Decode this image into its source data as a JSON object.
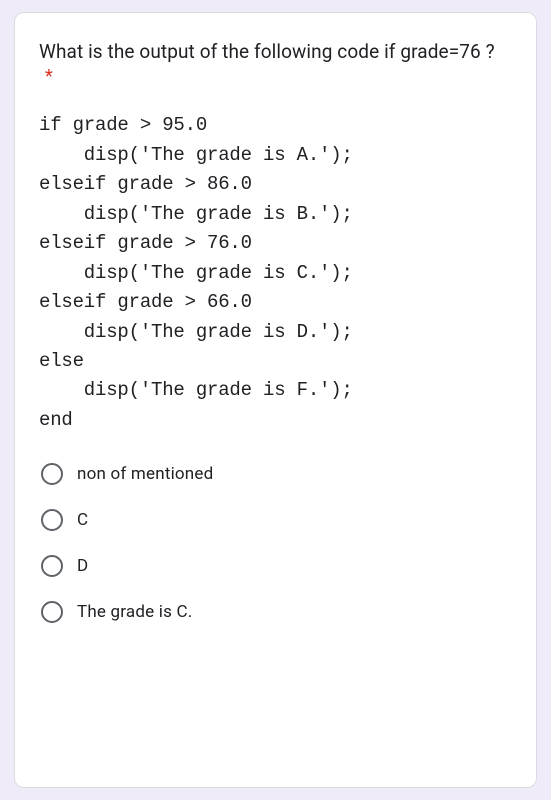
{
  "question": {
    "text": "What is the output of the following code if grade=76 ?",
    "required_mark": "*"
  },
  "code": "if grade > 95.0\n    disp('The grade is A.');\nelseif grade > 86.0\n    disp('The grade is B.');\nelseif grade > 76.0\n    disp('The grade is C.');\nelseif grade > 66.0\n    disp('The grade is D.');\nelse\n    disp('The grade is F.');\nend",
  "options": [
    {
      "label": "non of mentioned"
    },
    {
      "label": "C"
    },
    {
      "label": "D"
    },
    {
      "label": "The grade is C."
    }
  ]
}
